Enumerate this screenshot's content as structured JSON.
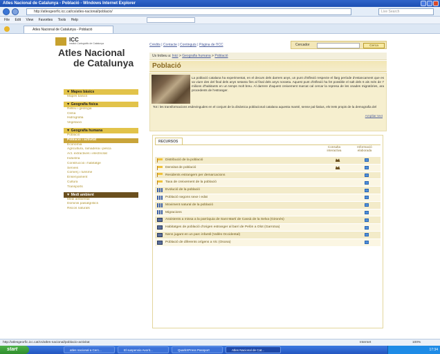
{
  "browser": {
    "title": "Atles Nacional de Catalunya - Població - Windows Internet Explorer",
    "url": "http://atlesgeorfic.icc.cat/cs/atles-nacional/poblacio/",
    "search_placeholder": "Live Search",
    "menu": [
      "File",
      "Edit",
      "View",
      "Favorites",
      "Tools",
      "Help"
    ],
    "tab_label": "Atles Nacional de Catalunya - Població",
    "status_url": "http://atlesgeorfic.icc.cat/cs/atles-nacional/poblacio-activitat",
    "status_zone": "Internet",
    "zoom": "100%"
  },
  "logo": {
    "icc": "ICC",
    "icc_sub": "Institut Cartogràfic de Catalunya",
    "line1": "Atles Nacional",
    "line2": "de Catalunya"
  },
  "nav": {
    "sections": [
      {
        "title": "▼ Mapes bàsics",
        "dark": false,
        "items": [
          "Mapes bàsics"
        ]
      },
      {
        "title": "▼ Geografia física",
        "dark": false,
        "items": [
          "Relleu i geologia",
          "Clima",
          "Hidrografia",
          "Vegetació"
        ]
      },
      {
        "title": "▼ Geografia humana",
        "dark": false,
        "items": [
          "Població",
          "Població i activitat",
          "Economia",
          "Agricultura, ramaderia i pesca",
          "Act. extractives i electricitat",
          "Indústria",
          "Construcció i habitatge",
          "Serveis",
          "Comerç i turisme",
          "Ensenyament",
          "Cultura",
          "Transports"
        ]
      },
      {
        "title": "▼ Medi ambient",
        "dark": true,
        "items": [
          "Medi ambiental",
          "Dominis paisatgístics",
          "Riscos naturals"
        ]
      }
    ]
  },
  "toplinks": [
    "Crèdits",
    "Contacte",
    "Continguts",
    "Pàgina de l'ICC"
  ],
  "search": {
    "label": "Cercador",
    "button": "Cerca"
  },
  "breadcrumb": {
    "prefix": "Us trobeu a:",
    "items": [
      "Inici",
      "Geografia humana",
      "Població"
    ]
  },
  "page": {
    "title": "Població",
    "intro1": "La població catalana ha experimentat, en el decurs dels darrers anys, un punt d'inflexió respecte el llarg període d'estancament que es va viure des del final dels anys setanta fins al final dels anys noranta. Aquest punt d'inflexió ha fet possible el salt dels 6 als més de 7 milions d'habitants en un temps molt breu. Al darrere d'aquest creixement marcat cal cercar la represa de les onades migratòries, ara procedents de l'estranger.",
    "intro2": "Tot i les transformacions esdevingudes en el conjunt de la dinàmica poblacional catalana aquesta manté, sense pal·liatius, els trets propis de la demografia del",
    "more": "Ampliar text"
  },
  "recursos": {
    "tab": "RECURSOS",
    "col1": "Consulta interactiva",
    "col2": "Informació elaborada",
    "rows": [
      {
        "icon": "flag",
        "label": "Distribució de la població",
        "interactive": true,
        "info": true
      },
      {
        "icon": "flag",
        "label": "Densitat de població",
        "interactive": true,
        "info": true
      },
      {
        "icon": "flag",
        "label": "Residents estrangers per demarcacions",
        "interactive": false,
        "info": true
      },
      {
        "icon": "flag",
        "label": "Taxa de creixement de la població",
        "interactive": false,
        "info": true
      },
      {
        "icon": "bars",
        "label": "Evolució de la població",
        "interactive": false,
        "info": true
      },
      {
        "icon": "bars",
        "label": "Població segons sexe i edat",
        "interactive": false,
        "info": true
      },
      {
        "icon": "bars",
        "label": "Moviment natural de la població",
        "interactive": false,
        "info": true
      },
      {
        "icon": "bars",
        "label": "Migracions",
        "interactive": false,
        "info": true
      },
      {
        "icon": "img",
        "label": "Assistents a missa a la parròquia de Sant Martí de Cassà de la Selva (Gironès)",
        "interactive": false,
        "info": true
      },
      {
        "icon": "img",
        "label": "Habitatges de població d'origen estranger al barri de Pelòn a Olot (Garrotxa)",
        "interactive": false,
        "info": true
      },
      {
        "icon": "img",
        "label": "Nens jugant en un parc infantil (Vallès Occidental)",
        "interactive": false,
        "info": true
      },
      {
        "icon": "img",
        "label": "Població de diferents orígens a Vic (Osona)",
        "interactive": false,
        "info": true
      }
    ]
  },
  "taskbar": {
    "start": "start",
    "tasks": [
      "atles nacional a Cerc...",
      "El suspensio Avorit...",
      "QuarkXPress Passport",
      "Atles Nacional de Cat..."
    ],
    "clock": "17:34"
  },
  "colors": {
    "accent": "#e2c34a",
    "title_text": "#8a6a21",
    "link": "#4a5c9a"
  }
}
